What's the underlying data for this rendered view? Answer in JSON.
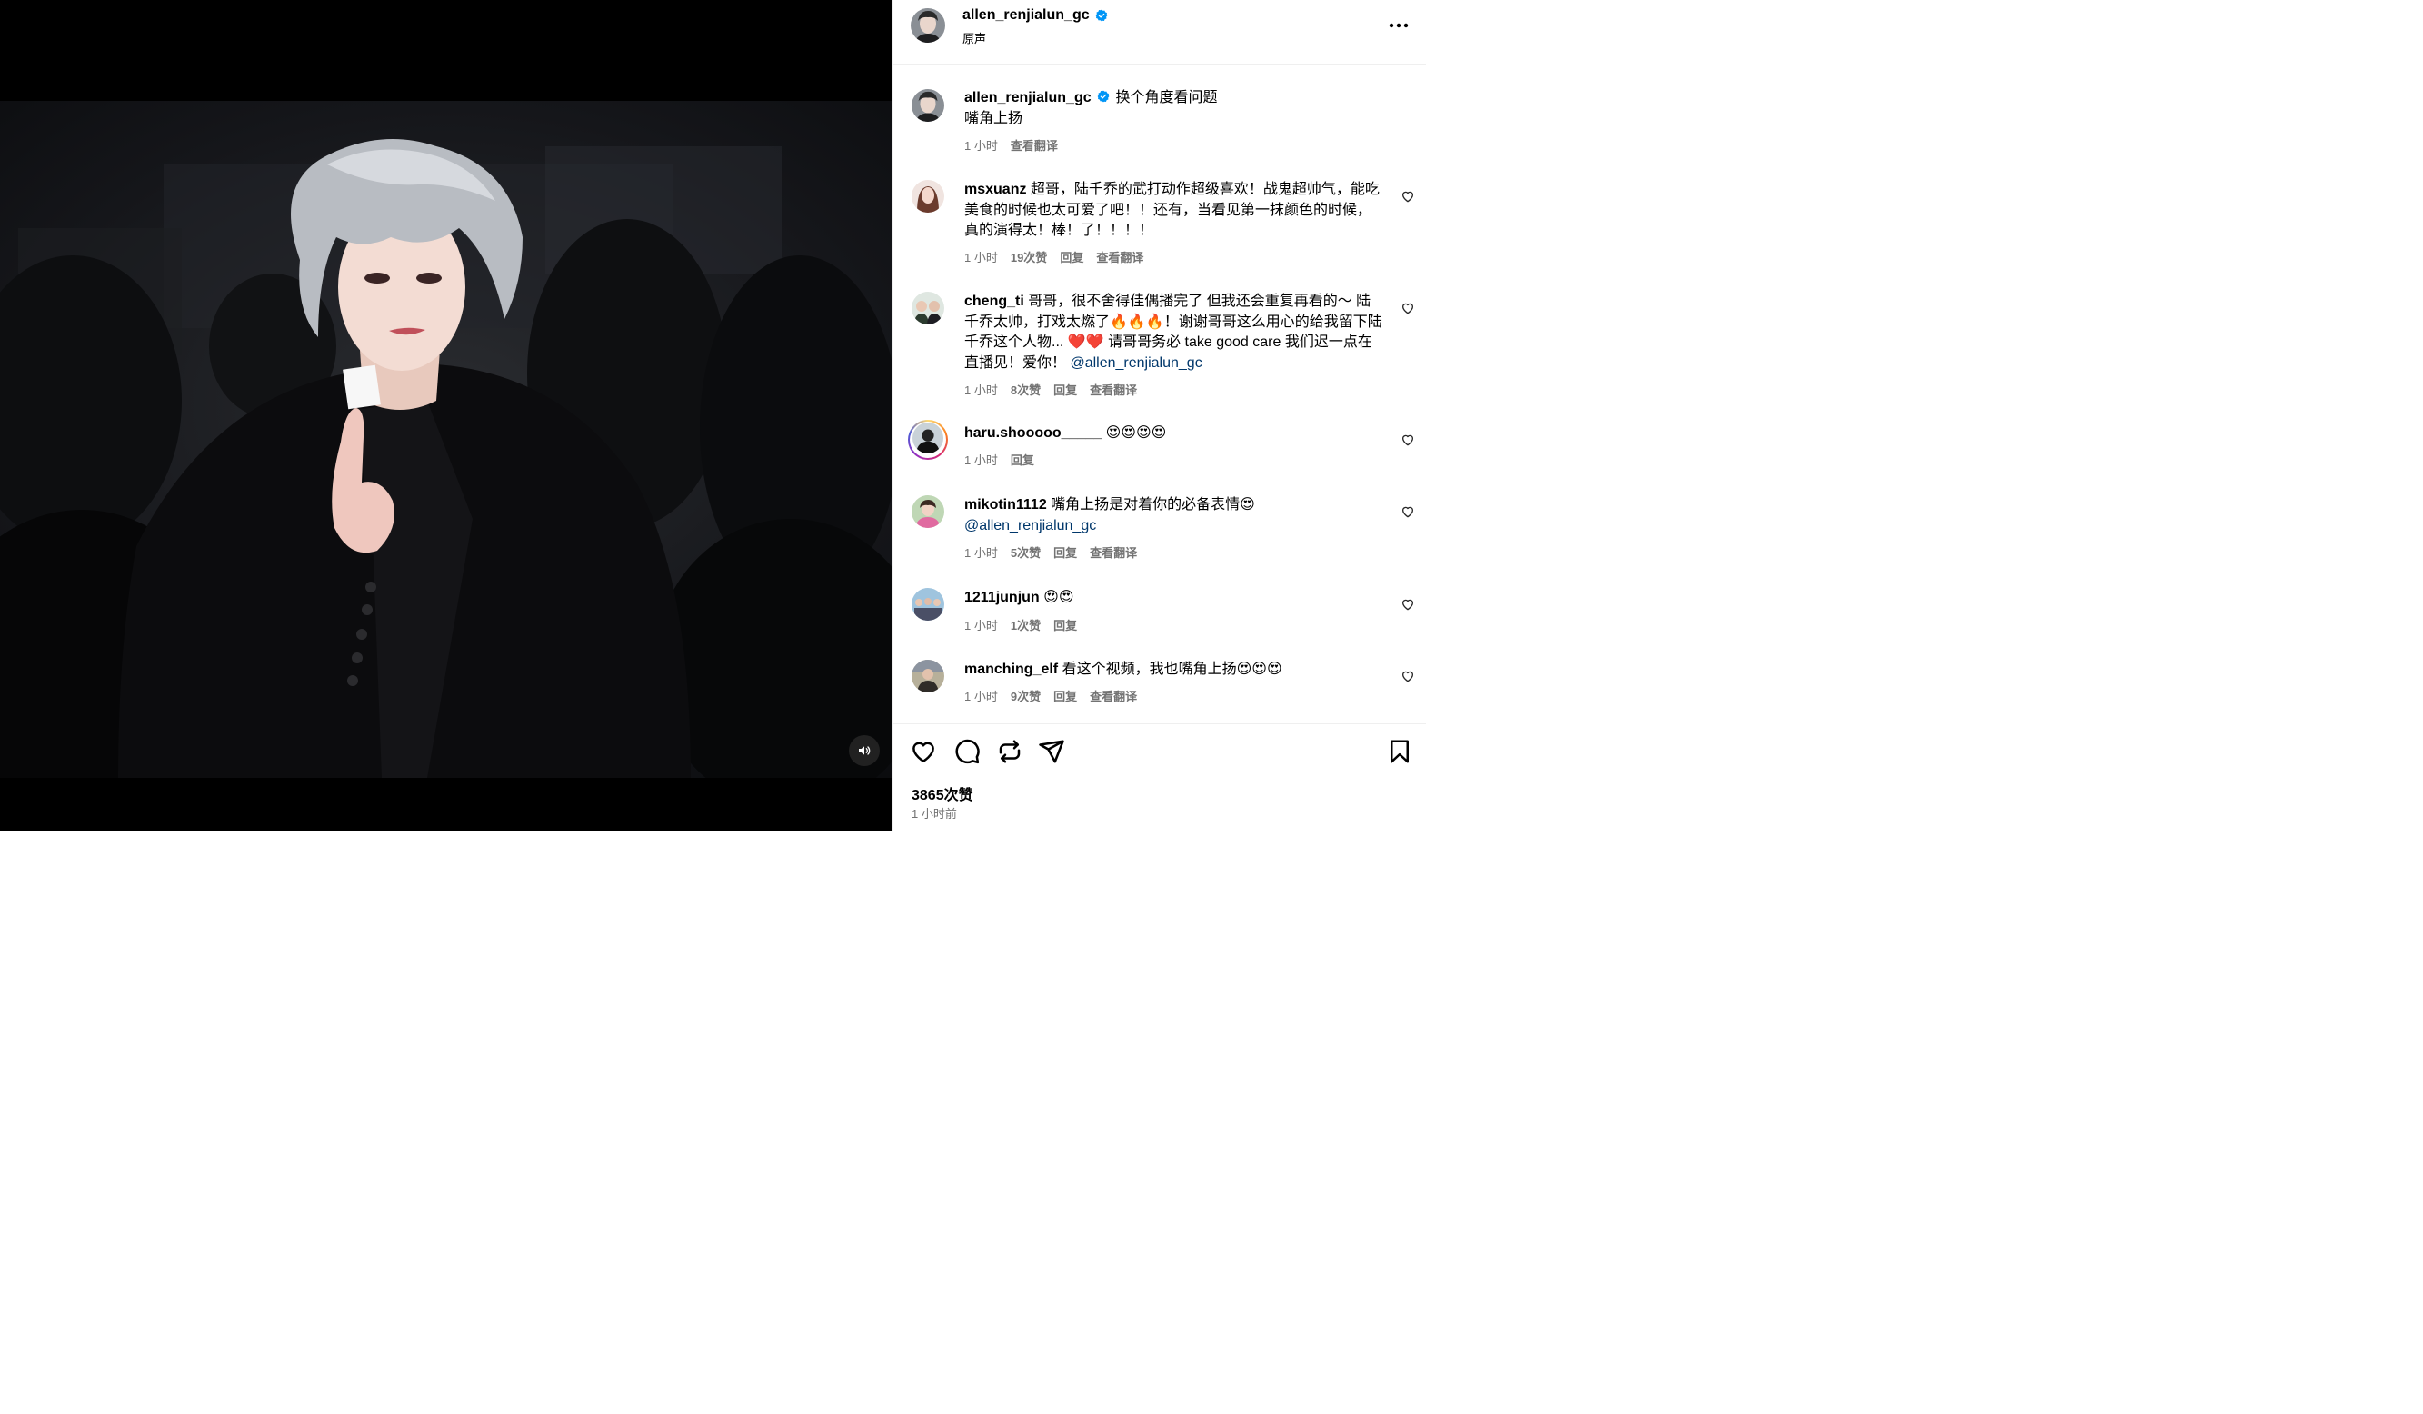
{
  "post": {
    "username": "allen_renjialun_gc",
    "audio": "原声",
    "more_icon": "more-horizontal-icon",
    "likes": "3865次赞",
    "time_ago": "1 小时前"
  },
  "caption": {
    "username": "allen_renjialun_gc",
    "text": "换个角度看问题",
    "text2": "嘴角上扬",
    "time": "1 小时",
    "translate": "查看翻译"
  },
  "comments": [
    {
      "username": "msxuanz",
      "text": "超哥，陆千乔的武打动作超级喜欢！战鬼超帅气，能吃美食的时候也太可爱了吧！！还有，当看见第一抹颜色的时候，真的演得太！棒！了！！！！",
      "time": "1 小时",
      "likes": "19次赞",
      "reply": "回复",
      "translate": "查看翻译"
    },
    {
      "username": "cheng_ti",
      "text": "哥哥，很不舍得佳偶播完了 但我还会重复再看的～ 陆千乔太帅，打戏太燃了🔥🔥🔥！谢谢哥哥这么用心的给我留下陆千乔这个人物... ❤️❤️ 请哥哥务必 take good care 我们迟一点在直播见！爱你！",
      "mention": "@allen_renjialun_gc",
      "time": "1 小时",
      "likes": "8次赞",
      "reply": "回复",
      "translate": "查看翻译"
    },
    {
      "username": "haru.shooooo_____",
      "text": "😍😍😍😍",
      "time": "1 小时",
      "reply": "回复"
    },
    {
      "username": "mikotin1112",
      "text": "嘴角上扬是对着你的必备表情😍",
      "mention": "@allen_renjialun_gc",
      "time": "1 小时",
      "likes": "5次赞",
      "reply": "回复",
      "translate": "查看翻译"
    },
    {
      "username": "1211junjun",
      "text": "😍😍",
      "time": "1 小时",
      "likes": "1次赞",
      "reply": "回复"
    },
    {
      "username": "manching_elf",
      "text": "看这个视频，我也嘴角上扬😍😍😍",
      "time": "1 小时",
      "likes": "9次赞",
      "reply": "回复",
      "translate": "查看翻译"
    }
  ],
  "icons": {
    "like": "heart-icon",
    "comment": "comment-icon",
    "repost": "repost-icon",
    "share": "share-icon",
    "save": "bookmark-icon",
    "sound": "speaker-icon",
    "verified": "verified-badge-icon"
  },
  "colors": {
    "verified": "#0095f6",
    "meta": "#737373",
    "mention": "#00376b"
  }
}
